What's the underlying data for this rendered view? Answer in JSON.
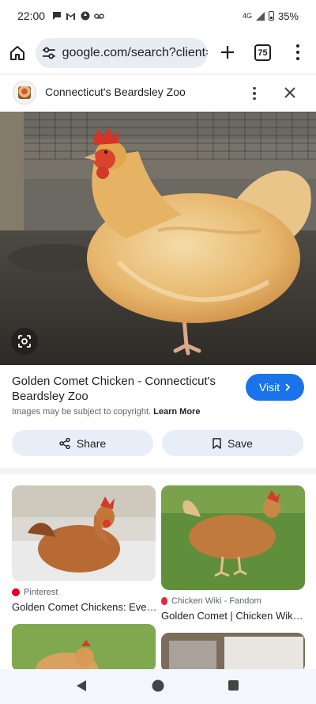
{
  "status_bar": {
    "time": "22:00",
    "network": "4G",
    "battery": "35%",
    "icons": [
      "chat-icon",
      "gmail-icon",
      "pinwheel-icon",
      "voicemail-icon"
    ]
  },
  "browser": {
    "url": "google.com/search?client=",
    "tab_count": "75",
    "icons": [
      "home-icon",
      "site-settings-icon",
      "new-tab-icon",
      "tabs-icon",
      "more-icon"
    ]
  },
  "panel": {
    "source_name": "Connecticut's Beardsley Zoo",
    "image_title": "Golden Comet Chicken - Connecticut's Beardsley Zoo",
    "visit_label": "Visit",
    "copyright_text": "Images may be subject to copyright.",
    "learn_more": "Learn More",
    "share_label": "Share",
    "save_label": "Save"
  },
  "related": [
    {
      "source": "Pinterest",
      "title": "Golden Comet Chickens: Eve…",
      "source_icon": "pinterest-icon"
    },
    {
      "source": "Chicken Wiki - Fandom",
      "title": "Golden Comet | Chicken Wik…",
      "source_icon": "fandom-icon"
    }
  ],
  "colors": {
    "accent": "#1a73e8",
    "chip_bg": "#e8eef8",
    "omnibox_bg": "#e8ecf3"
  }
}
